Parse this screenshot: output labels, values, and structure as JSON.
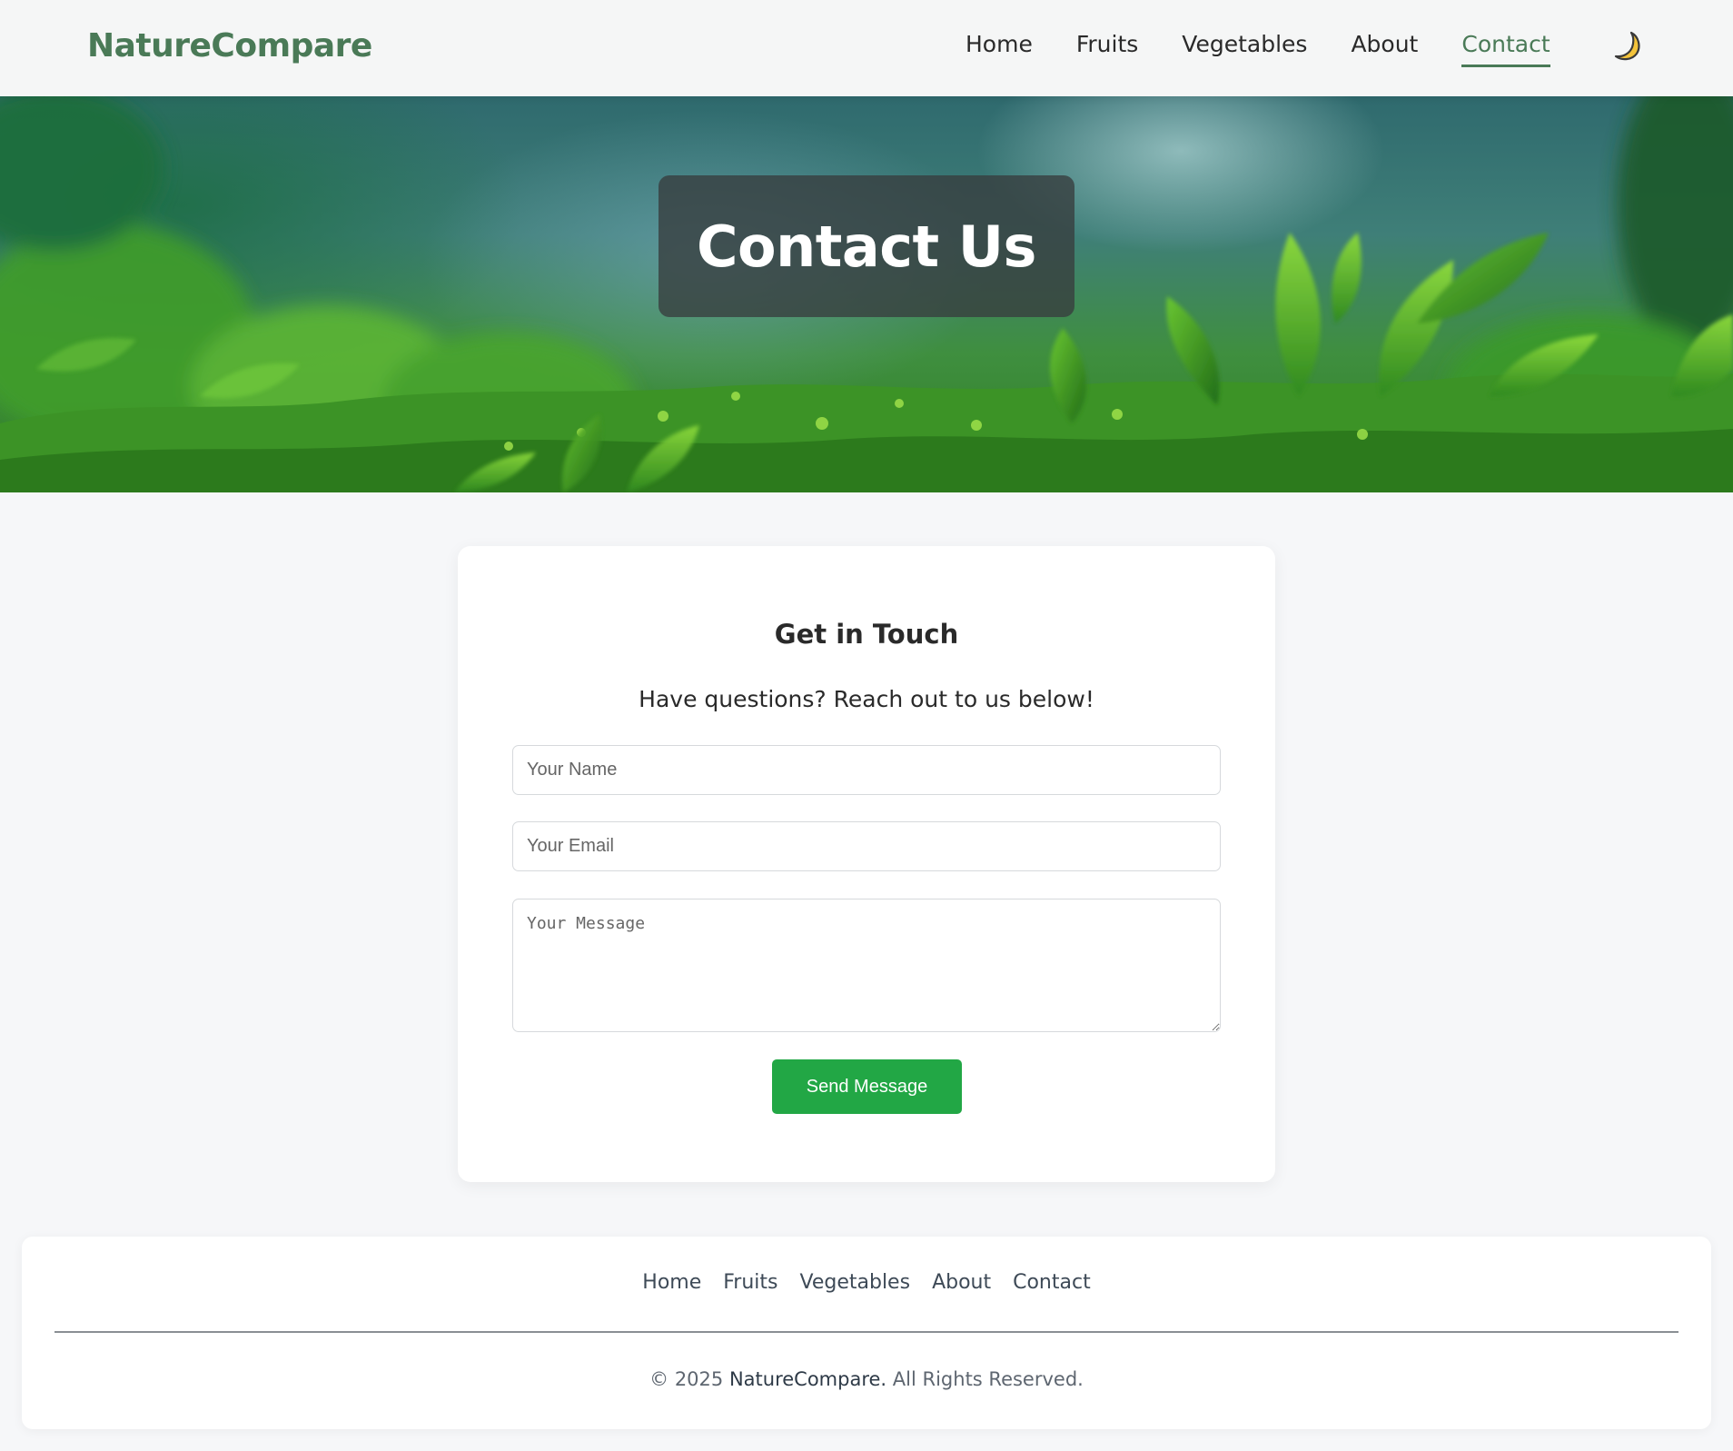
{
  "header": {
    "brand": "NatureCompare",
    "nav": [
      {
        "label": "Home"
      },
      {
        "label": "Fruits"
      },
      {
        "label": "Vegetables"
      },
      {
        "label": "About"
      },
      {
        "label": "Contact",
        "active": true
      }
    ],
    "theme_toggle_icon": "moon-icon"
  },
  "hero": {
    "title": "Contact Us"
  },
  "contact": {
    "title": "Get in Touch",
    "subtitle": "Have questions? Reach out to us below!",
    "name_placeholder": "Your Name",
    "email_placeholder": "Your Email",
    "message_placeholder": "Your Message",
    "submit_label": "Send Message"
  },
  "footer": {
    "links": [
      {
        "label": "Home"
      },
      {
        "label": "Fruits"
      },
      {
        "label": "Vegetables"
      },
      {
        "label": "About"
      },
      {
        "label": "Contact"
      }
    ],
    "copyright_prefix": "© 2025",
    "copyright_brand": "NatureCompare.",
    "copyright_suffix": "All Rights Reserved."
  },
  "colors": {
    "brand": "#4a7a57",
    "button": "#22a745",
    "page_bg": "#f6f7f9"
  }
}
